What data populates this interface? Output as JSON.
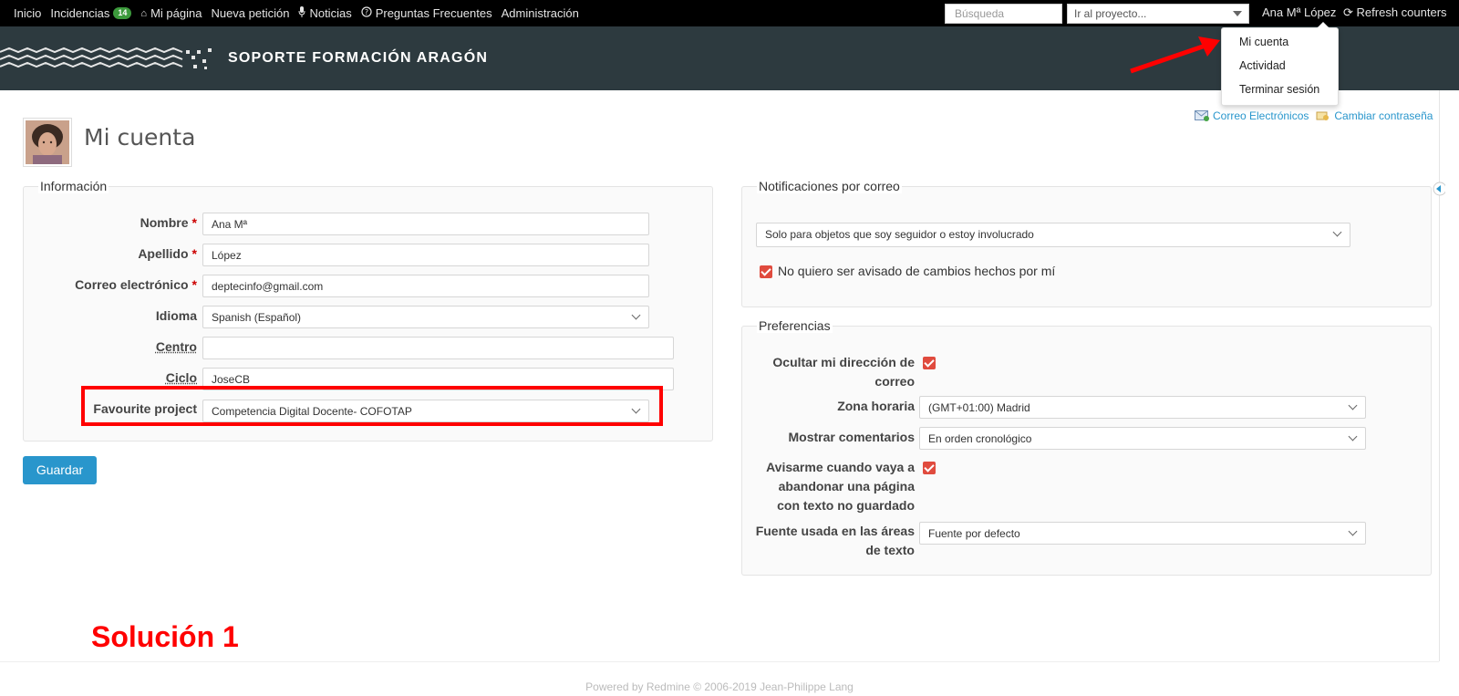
{
  "top_menu": {
    "items": [
      {
        "label": "Inicio"
      },
      {
        "label": "Incidencias",
        "badge": "14"
      },
      {
        "label": "Mi página",
        "icon": "home-icon"
      },
      {
        "label": "Nueva petición"
      },
      {
        "label": "Noticias",
        "icon": "microphone-icon"
      },
      {
        "label": "Preguntas Frecuentes",
        "icon": "question-circle-icon"
      },
      {
        "label": "Administración"
      }
    ],
    "search_placeholder": "Búsqueda",
    "jump_label": "Ir al proyecto...",
    "user": "Ana Mª López",
    "refresh": "Refresh counters"
  },
  "header": {
    "title": "SOPORTE FORMACIÓN ARAGÓN"
  },
  "user_menu": {
    "items": [
      "Mi cuenta",
      "Actividad",
      "Terminar sesión"
    ]
  },
  "page": {
    "title": "Mi cuenta",
    "contextual": {
      "emails": "Correo Electrónicos",
      "password": "Cambiar contraseña"
    }
  },
  "info": {
    "legend": "Información",
    "fields": [
      {
        "label": "Nombre",
        "value": "Ana Mª",
        "required": "*"
      },
      {
        "label": "Apellido",
        "value": "López",
        "required": "*"
      },
      {
        "label": "Correo electrónico",
        "value": "deptecinfo@gmail.com",
        "required": "*"
      },
      {
        "label": "Idioma",
        "value": "Spanish (Español)"
      },
      {
        "label": "Centro",
        "value": ""
      },
      {
        "label": "Ciclo",
        "value": "JoseCB"
      },
      {
        "label": "Favourite project",
        "value": "Competencia Digital Docente- COFOTAP"
      }
    ]
  },
  "notifications": {
    "legend": "Notificaciones por correo",
    "select": "Solo para objetos que soy seguidor o estoy involucrado",
    "no_self": "No quiero ser avisado de cambios hechos por mí"
  },
  "preferences": {
    "legend": "Preferencias",
    "hide_mail_1": "Ocultar mi dirección de",
    "hide_mail_2": "correo",
    "timezone_label": "Zona horaria",
    "timezone_value": "(GMT+01:00) Madrid",
    "comments_label": "Mostrar comentarios",
    "comments_value": "En orden cronológico",
    "warn_1": "Avisarme cuando vaya a",
    "warn_2": "abandonar una página",
    "warn_3": "con texto no guardado",
    "font_1": "Fuente usada en las áreas",
    "font_2": "de texto",
    "font_value": "Fuente por defecto"
  },
  "actions": {
    "save": "Guardar"
  },
  "annotation": "Solución 1",
  "footer": "Powered by Redmine © 2006-2019 Jean-Philippe Lang",
  "colors": {
    "accent": "#2996cc",
    "header": "#2d3a3f",
    "annotation": "#ff0000",
    "checkbox": "#e04b3e"
  }
}
